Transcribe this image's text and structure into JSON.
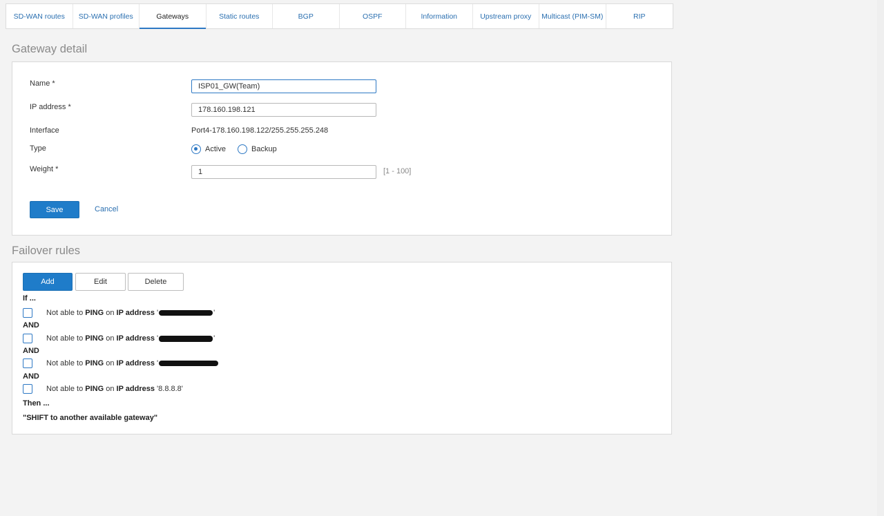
{
  "tabs": [
    {
      "label": "SD-WAN routes"
    },
    {
      "label": "SD-WAN profiles"
    },
    {
      "label": "Gateways",
      "active": true
    },
    {
      "label": "Static routes"
    },
    {
      "label": "BGP"
    },
    {
      "label": "OSPF"
    },
    {
      "label": "Information"
    },
    {
      "label": "Upstream proxy"
    },
    {
      "label": "Multicast (PIM-SM)"
    },
    {
      "label": "RIP"
    }
  ],
  "gateway_detail": {
    "title": "Gateway detail",
    "name_label": "Name *",
    "name_value": "ISP01_GW(Team)",
    "ip_label": "IP address *",
    "ip_value": "178.160.198.121",
    "interface_label": "Interface",
    "interface_value": "Port4-178.160.198.122/255.255.255.248",
    "type_label": "Type",
    "type_options": [
      "Active",
      "Backup"
    ],
    "type_selected": "Active",
    "weight_label": "Weight *",
    "weight_value": "1",
    "weight_hint": "[1 - 100]",
    "save_label": "Save",
    "cancel_label": "Cancel"
  },
  "failover": {
    "title": "Failover rules",
    "add_label": "Add",
    "edit_label": "Edit",
    "delete_label": "Delete",
    "if_label": "If ...",
    "and_label": "AND",
    "then_label": "Then ...",
    "action_text": "\"SHIFT to another available gateway\"",
    "rule_prefix": "Not able to",
    "rule_protocol": "PING",
    "rule_on": "on",
    "rule_target": "IP address",
    "rules": [
      {
        "ip": "",
        "redacted": true
      },
      {
        "ip": "",
        "redacted": true
      },
      {
        "ip": "",
        "redacted": true
      },
      {
        "ip": "8.8.8.8",
        "redacted": false
      }
    ]
  }
}
